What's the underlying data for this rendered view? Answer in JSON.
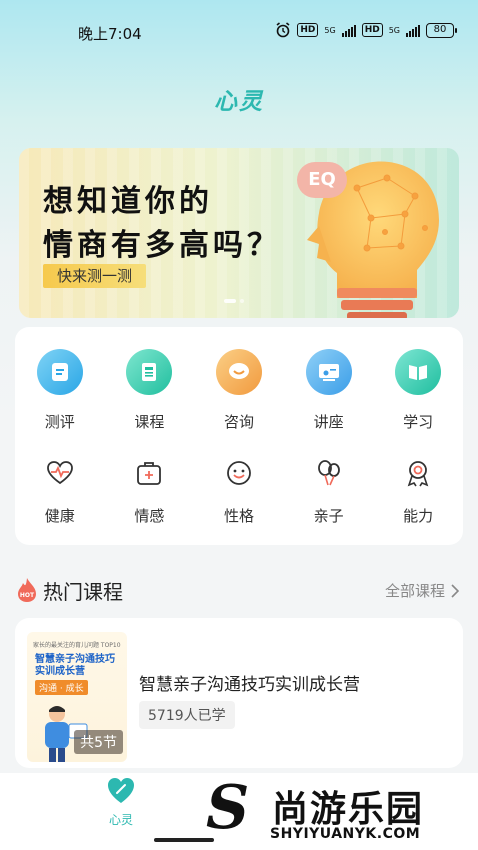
{
  "status_bar": {
    "time": "晚上7:04",
    "hd1": "HD",
    "net1": "5G",
    "hd2": "HD",
    "net2": "5G",
    "battery": "80"
  },
  "app_title": "心灵",
  "banner": {
    "line1": "想知道你的",
    "line2": "情商有多高吗？",
    "cta": "快来测一测",
    "eq": "EQ"
  },
  "grid": {
    "row1": [
      {
        "label": "测评",
        "icon": "clipboard-icon",
        "color": "#3bb3e8"
      },
      {
        "label": "课程",
        "icon": "book-icon",
        "color": "#2fc4a9"
      },
      {
        "label": "咨询",
        "icon": "chat-icon",
        "color": "#f3a54b"
      },
      {
        "label": "讲座",
        "icon": "lecture-icon",
        "color": "#4aa8ea"
      },
      {
        "label": "学习",
        "icon": "study-icon",
        "color": "#2ccab0"
      }
    ],
    "row2": [
      {
        "label": "健康",
        "icon": "heartbeat-icon"
      },
      {
        "label": "情感",
        "icon": "medkit-icon"
      },
      {
        "label": "性格",
        "icon": "smile-icon"
      },
      {
        "label": "亲子",
        "icon": "balloons-icon"
      },
      {
        "label": "能力",
        "icon": "medal-icon"
      }
    ]
  },
  "hot_section": {
    "badge": "HOT",
    "title": "热门课程",
    "see_all": "全部课程"
  },
  "course": {
    "thumb_top": "家长的最关注的育儿问题 TOP10",
    "thumb_title_1": "智慧亲子沟通技巧",
    "thumb_title_2": "实训成长营",
    "thumb_sub": "沟通 · 成长",
    "lessons": "共5节",
    "name": "智慧亲子沟通技巧实训成长营",
    "learners": "5719人已学"
  },
  "tab_bar": {
    "home_label": "心灵"
  },
  "watermark": {
    "logo_letter": "S",
    "name": "尚游乐园",
    "url": "SHYIYUANYK.COM"
  },
  "colors": {
    "accent": "#2cb8b0",
    "hot": "#f06a5a"
  }
}
